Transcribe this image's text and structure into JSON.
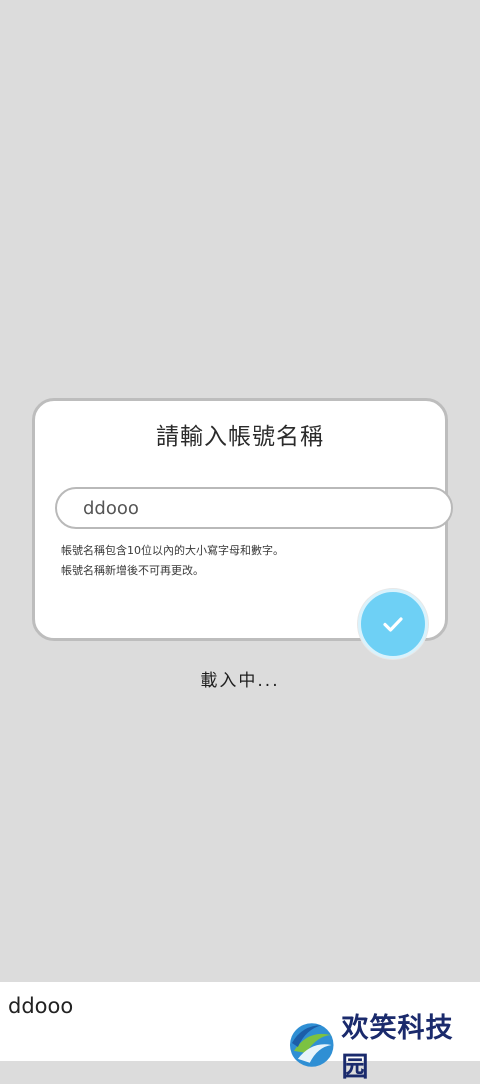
{
  "dialog": {
    "title": "請輸入帳號名稱",
    "input_value": "ddooo",
    "hint_line1": "帳號名稱包含10位以內的大小寫字母和數字。",
    "hint_line2": "帳號名稱新增後不可再更改。"
  },
  "loading_text": "載入中...",
  "bottom_bar": {
    "text": "ddooo",
    "brand_name": "欢笑科技园"
  },
  "colors": {
    "background": "#dcdcdc",
    "confirm_button": "#6ed0f5",
    "brand_text": "#1a2a6c"
  }
}
